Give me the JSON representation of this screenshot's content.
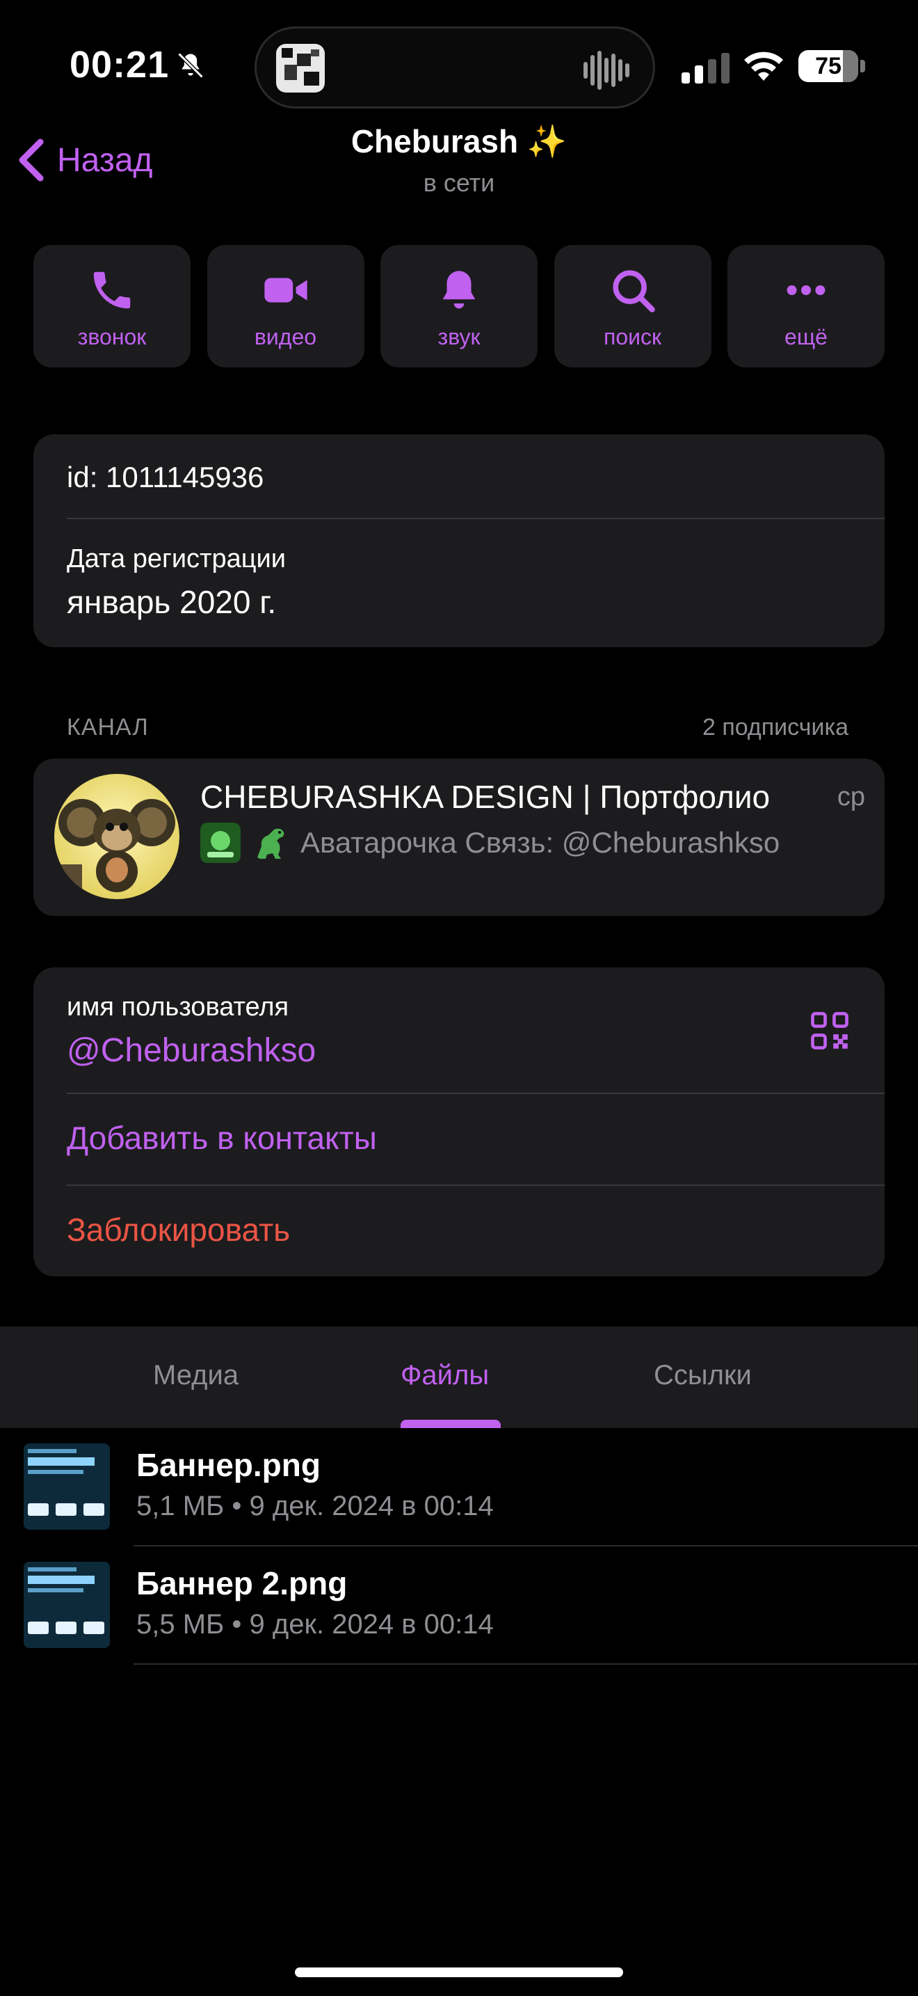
{
  "status_bar": {
    "time": "00:21",
    "battery": "75",
    "battery_level": 0.75
  },
  "header": {
    "back_label": "Назад",
    "title": "Cheburash ✨",
    "subtitle": "в сети"
  },
  "actions": [
    {
      "label": "звонок",
      "icon": "phone-icon"
    },
    {
      "label": "видео",
      "icon": "video-icon"
    },
    {
      "label": "звук",
      "icon": "bell-icon"
    },
    {
      "label": "поиск",
      "icon": "search-icon"
    },
    {
      "label": "ещё",
      "icon": "more-icon"
    }
  ],
  "info": {
    "id": "id: 1011145936",
    "reg_label": "Дата регистрации",
    "reg_value": "январь 2020 г."
  },
  "channel_section": {
    "heading": "КАНАЛ",
    "count": "2 подписчика"
  },
  "channel": {
    "name": "CHEBURASHKA DESIGN | Портфолио",
    "day": "ср",
    "description": "Аватарочка Связь: @Cheburashkso"
  },
  "user": {
    "label": "имя пользователя",
    "handle": "@Cheburashkso",
    "add_contact": "Добавить в контакты",
    "block": "Заблокировать"
  },
  "tabs": [
    {
      "label": "Медиа",
      "active": false
    },
    {
      "label": "Файлы",
      "active": true
    },
    {
      "label": "Ссылки",
      "active": false
    }
  ],
  "files": [
    {
      "name": "Баннер.png",
      "meta": "5,1 МБ • 9 дек. 2024 в 00:14"
    },
    {
      "name": "Баннер 2.png",
      "meta": "5,5 МБ • 9 дек. 2024 в 00:14"
    }
  ],
  "colors": {
    "accent": "#c061f0",
    "destructive": "#eb5545",
    "card": "#1c1c1e",
    "secondary_text": "#8e8e93"
  }
}
